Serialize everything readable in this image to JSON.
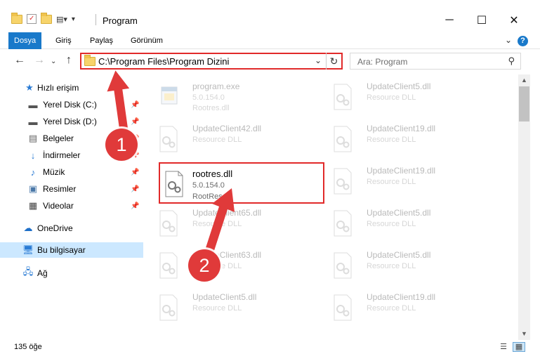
{
  "window": {
    "title": "Program",
    "minimize": "─",
    "maximize": "☐",
    "close": "✕"
  },
  "ribbon": {
    "tabs": [
      "Dosya",
      "Giriş",
      "Paylaş",
      "Görünüm"
    ],
    "help": "?"
  },
  "nav": {
    "address": "C:\\Program Files\\Program Dizini",
    "search_placeholder": "Ara: Program"
  },
  "sidebar": {
    "items": [
      {
        "label": "Hızlı erişim",
        "icon": "star-icon"
      },
      {
        "label": "Yerel Disk (C:)",
        "icon": "drive-icon"
      },
      {
        "label": "Yerel Disk (D:)",
        "icon": "drive-icon"
      },
      {
        "label": "Belgeler",
        "icon": "documents-icon"
      },
      {
        "label": "İndirmeler",
        "icon": "download-icon"
      },
      {
        "label": "Müzik",
        "icon": "music-icon"
      },
      {
        "label": "Resimler",
        "icon": "pictures-icon"
      },
      {
        "label": "Videolar",
        "icon": "videos-icon"
      },
      {
        "label": "OneDrive",
        "icon": "cloud-icon"
      },
      {
        "label": "Bu bilgisayar",
        "icon": "computer-icon"
      },
      {
        "label": "Ağ",
        "icon": "network-icon"
      }
    ]
  },
  "files": [
    {
      "name": "program.exe",
      "line2": "5.0.154.0",
      "line3": "Rootres.dll"
    },
    {
      "name": "UpdateClient5.dll",
      "line2": "Resource DLL",
      "line3": ""
    },
    {
      "name": "UpdateClient42.dll",
      "line2": "Resource DLL",
      "line3": ""
    },
    {
      "name": "UpdateClient19.dll",
      "line2": "Resource DLL",
      "line3": ""
    },
    {
      "name": "rootres.dll",
      "line2": "5.0.154.0",
      "line3": "RootRes.dll"
    },
    {
      "name": "UpdateClient19.dll",
      "line2": "Resource DLL",
      "line3": ""
    },
    {
      "name": "UpdateClient65.dll",
      "line2": "Resource DLL",
      "line3": ""
    },
    {
      "name": "UpdateClient5.dll",
      "line2": "Resource DLL",
      "line3": ""
    },
    {
      "name": "UpdateClient63.dll",
      "line2": "Resource DLL",
      "line3": ""
    },
    {
      "name": "UpdateClient5.dll",
      "line2": "Resource DLL",
      "line3": ""
    },
    {
      "name": "UpdateClient5.dll",
      "line2": "Resource DLL",
      "line3": ""
    },
    {
      "name": "UpdateClient19.dll",
      "line2": "Resource DLL",
      "line3": ""
    }
  ],
  "status": {
    "count": "135 öğe"
  },
  "annotations": {
    "step1": "1",
    "step2": "2",
    "highlight_color": "#e12a2a"
  }
}
